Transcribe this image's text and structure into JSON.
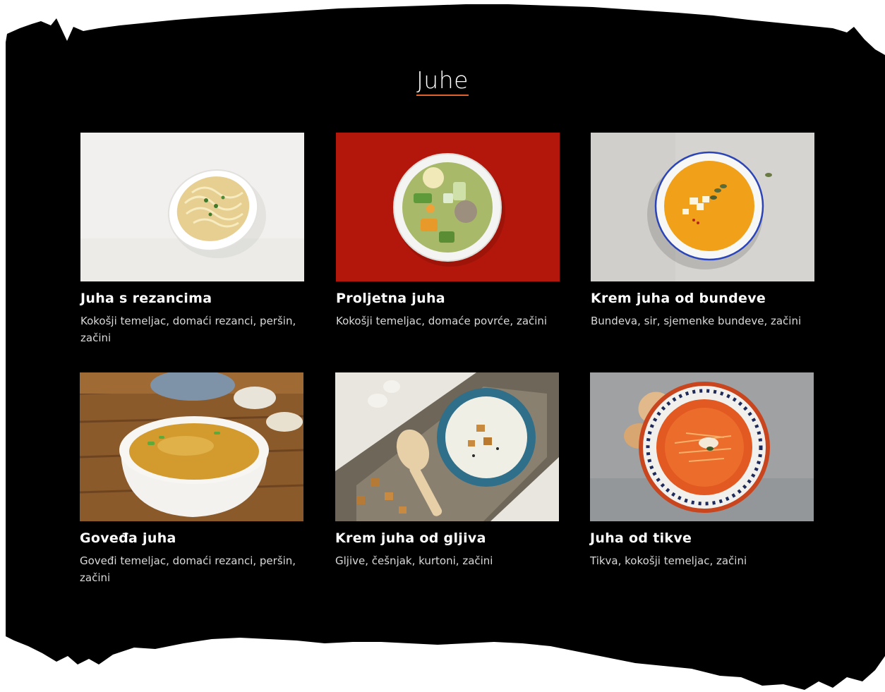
{
  "section": {
    "title": "Juhe"
  },
  "colors": {
    "background": "#000000",
    "accent_underline": "#e0612b",
    "heading_text": "#ffffff",
    "description_text": "#d9d9d9"
  },
  "soups": [
    {
      "name": "Juha s rezancima",
      "description": "Kokošji temeljac, domaći rezanci, peršin, začini",
      "photo": "clear noodle soup in white bowl on white marble"
    },
    {
      "name": "Proljetna juha",
      "description": "Kokošji temeljac, domaće povrće, začini",
      "photo": "vegetable broth in white bowl on red background"
    },
    {
      "name": "Krem juha od bundeve",
      "description": "Bundeva, sir, sjemenke bundeve, začini",
      "photo": "orange pumpkin cream soup in blue-rimmed bowl on grey stone"
    },
    {
      "name": "Goveđa juha",
      "description": "Goveđi temeljac, domaći rezanci, peršin, začini",
      "photo": "golden beef broth in white bowl on wooden table"
    },
    {
      "name": "Krem juha od gljiva",
      "description": "Gljive, češnjak, kurtoni, začini",
      "photo": "white mushroom cream soup in teal bowl with wooden spoon and croutons"
    },
    {
      "name": "Juha od tikve",
      "description": "Tikva, kokošji temeljac, začini",
      "photo": "orange squash soup with grated cheese in patterned bowl on grey surface"
    }
  ]
}
